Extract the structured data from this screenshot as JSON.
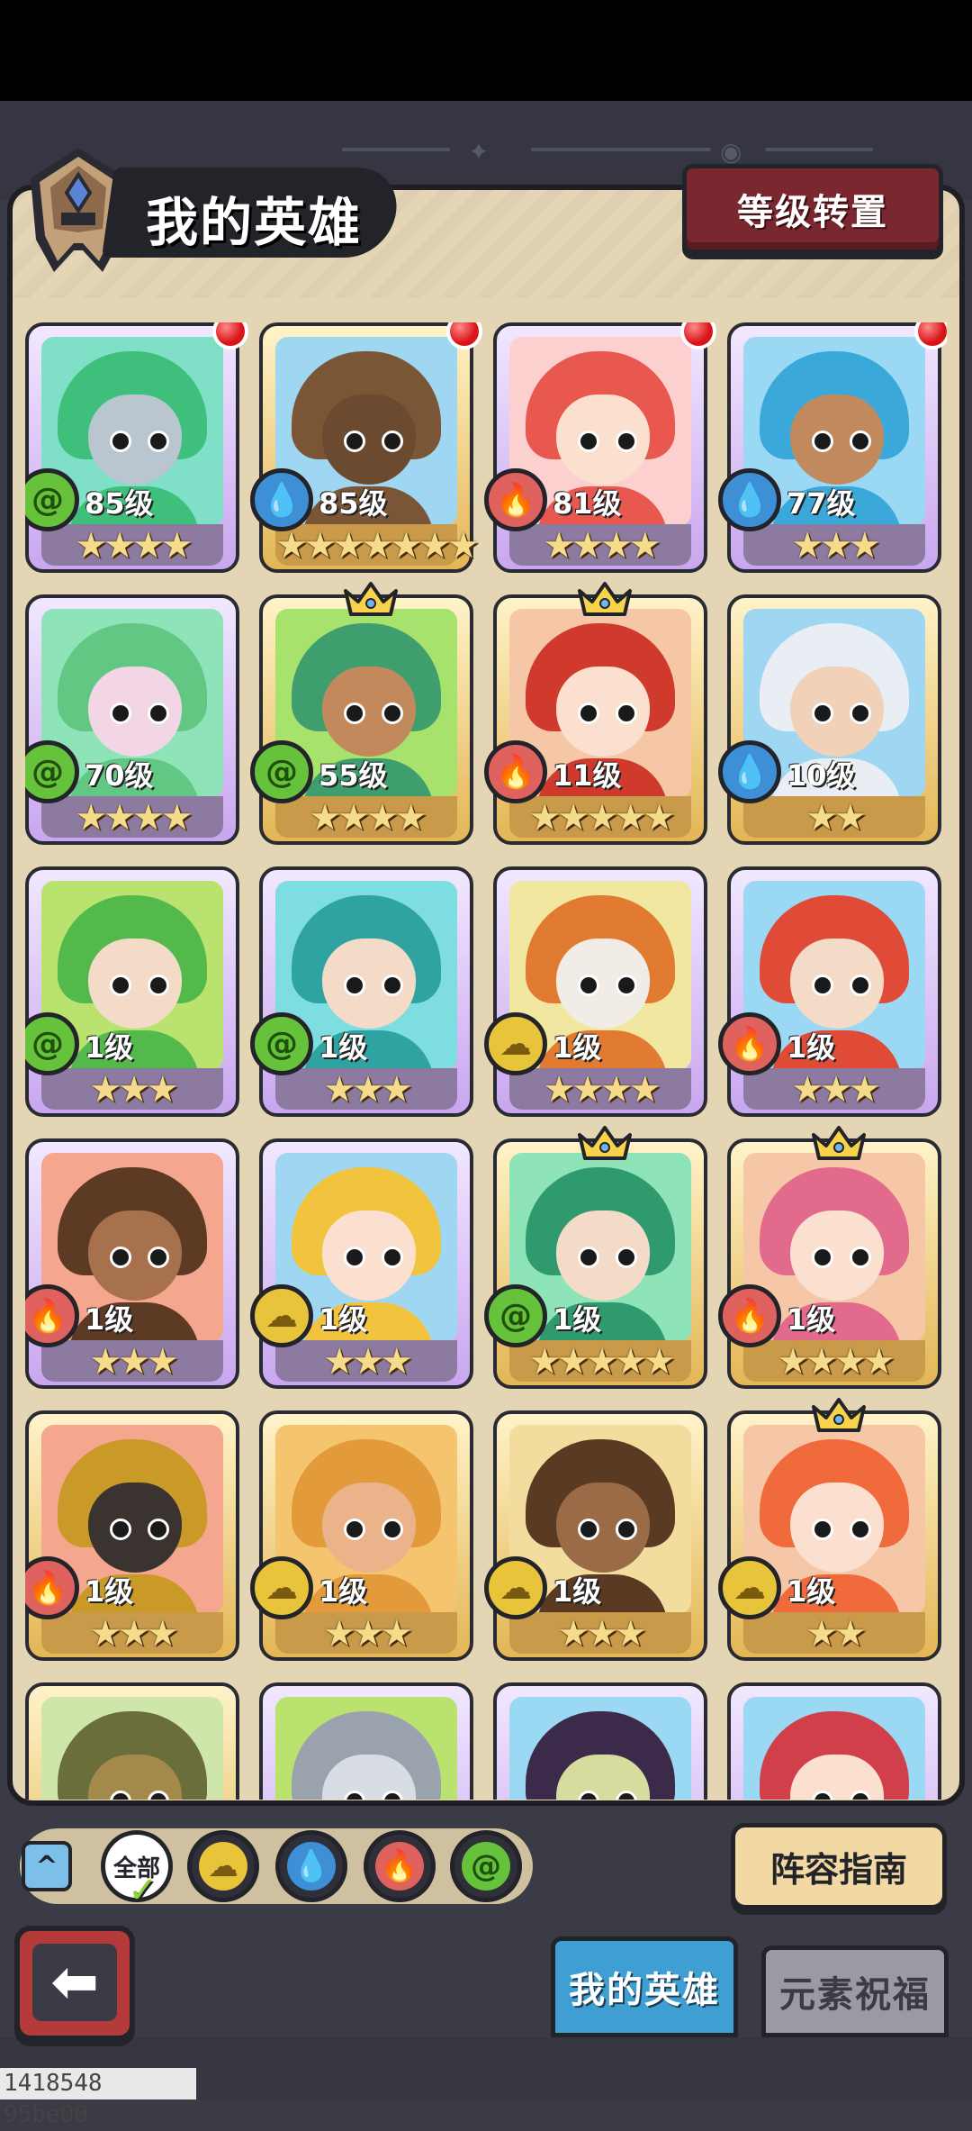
{
  "header": {
    "title": "我的英雄",
    "transfer_button": "等级转置"
  },
  "heroes": [
    {
      "level": "85级",
      "stars": "★★★★",
      "element": "wind",
      "frame": "purple",
      "dot": true,
      "crown": false,
      "hair": "#3fbf7c",
      "skin": "#b9c6cf",
      "bg": "#7fe0c7"
    },
    {
      "level": "85级",
      "stars": "★★★★★★★",
      "element": "water",
      "frame": "gold",
      "dot": true,
      "crown": false,
      "hair": "#7a5536",
      "skin": "#6b4a30",
      "bg": "#9fd6f1"
    },
    {
      "level": "81级",
      "stars": "★★★★",
      "element": "fire",
      "frame": "purple",
      "dot": true,
      "crown": false,
      "hair": "#e8584f",
      "skin": "#fbe0cf",
      "bg": "#fbd0cf"
    },
    {
      "level": "77级",
      "stars": "★★★",
      "element": "water",
      "frame": "purple",
      "dot": true,
      "crown": false,
      "hair": "#3aa8d8",
      "skin": "#c08a5e",
      "bg": "#9bd8f3"
    },
    {
      "level": "70级",
      "stars": "★★★★",
      "element": "wind",
      "frame": "purple",
      "dot": false,
      "crown": false,
      "hair": "#63c784",
      "skin": "#f3d6e6",
      "bg": "#8fe3b8"
    },
    {
      "level": "55级",
      "stars": "★★★★",
      "element": "wind",
      "frame": "gold",
      "dot": false,
      "crown": true,
      "hair": "#3f9e6d",
      "skin": "#c28a5c",
      "bg": "#a7e26c"
    },
    {
      "level": "11级",
      "stars": "★★★★★",
      "element": "fire",
      "frame": "gold",
      "dot": false,
      "crown": true,
      "hair": "#cf3a2c",
      "skin": "#fbe0cf",
      "bg": "#f5c7a7"
    },
    {
      "level": "10级",
      "stars": "★★",
      "element": "water",
      "frame": "gold",
      "dot": false,
      "crown": false,
      "hair": "#e8eef3",
      "skin": "#f1d2b9",
      "bg": "#9fd6f1"
    },
    {
      "level": "1级",
      "stars": "★★★",
      "element": "wind",
      "frame": "purple",
      "dot": false,
      "crown": false,
      "hair": "#53b94a",
      "skin": "#f4dbc8",
      "bg": "#b9e26f"
    },
    {
      "level": "1级",
      "stars": "★★★",
      "element": "wind",
      "frame": "purple",
      "dot": false,
      "crown": false,
      "hair": "#2fa3a1",
      "skin": "#f4dbc8",
      "bg": "#7ddde0"
    },
    {
      "level": "1级",
      "stars": "★★★★",
      "element": "earth",
      "frame": "purple",
      "dot": false,
      "crown": false,
      "hair": "#e27b32",
      "skin": "#f2ece6",
      "bg": "#f1e7a0"
    },
    {
      "level": "1级",
      "stars": "★★★",
      "element": "fire",
      "frame": "purple",
      "dot": false,
      "crown": false,
      "hair": "#e04b38",
      "skin": "#f4dbc8",
      "bg": "#9bd8f3"
    },
    {
      "level": "1级",
      "stars": "★★★",
      "element": "fire",
      "frame": "purple",
      "dot": false,
      "crown": false,
      "hair": "#5d3a24",
      "skin": "#a6714c",
      "bg": "#f4a68e"
    },
    {
      "level": "1级",
      "stars": "★★★",
      "element": "earth",
      "frame": "purple",
      "dot": false,
      "crown": false,
      "hair": "#f2c33d",
      "skin": "#fbe0cf",
      "bg": "#9fd6f1"
    },
    {
      "level": "1级",
      "stars": "★★★★★",
      "element": "wind",
      "frame": "gold",
      "dot": false,
      "crown": true,
      "hair": "#2e9a6e",
      "skin": "#f4dbc8",
      "bg": "#8fe3b8"
    },
    {
      "level": "1级",
      "stars": "★★★★",
      "element": "fire",
      "frame": "gold",
      "dot": false,
      "crown": true,
      "hair": "#e26a8c",
      "skin": "#fbe0cf",
      "bg": "#f5c7a7"
    },
    {
      "level": "1级",
      "stars": "★★★",
      "element": "fire",
      "frame": "gold",
      "dot": false,
      "crown": false,
      "hair": "#c99a28",
      "skin": "#3a3330",
      "bg": "#f4a68e"
    },
    {
      "level": "1级",
      "stars": "★★★",
      "element": "earth",
      "frame": "gold",
      "dot": false,
      "crown": false,
      "hair": "#e39a3a",
      "skin": "#eab38a",
      "bg": "#f4c56e"
    },
    {
      "level": "1级",
      "stars": "★★★",
      "element": "earth",
      "frame": "gold",
      "dot": false,
      "crown": false,
      "hair": "#5a3a22",
      "skin": "#9b6a46",
      "bg": "#f3dd9e"
    },
    {
      "level": "1级",
      "stars": "★★",
      "element": "earth",
      "frame": "gold",
      "dot": false,
      "crown": true,
      "hair": "#f06a3c",
      "skin": "#fbe0cf",
      "bg": "#f5c7a7"
    },
    {
      "level": "",
      "stars": "",
      "element": "",
      "frame": "gold",
      "dot": false,
      "crown": false,
      "hair": "#6a6e3a",
      "skin": "#a48a4a",
      "bg": "#cfe6ab"
    },
    {
      "level": "",
      "stars": "",
      "element": "",
      "frame": "purple",
      "dot": false,
      "crown": false,
      "hair": "#9aa3ad",
      "skin": "#d7dde3",
      "bg": "#b9e26f"
    },
    {
      "level": "",
      "stars": "",
      "element": "",
      "frame": "purple",
      "dot": false,
      "crown": false,
      "hair": "#3c2a4a",
      "skin": "#d6db9e",
      "bg": "#9bd8f3"
    },
    {
      "level": "",
      "stars": "",
      "element": "",
      "frame": "purple",
      "dot": false,
      "crown": false,
      "hair": "#d1404a",
      "skin": "#fbe0cf",
      "bg": "#9bd8f3"
    }
  ],
  "filters": {
    "all_label": "全部",
    "items": [
      "earth",
      "water",
      "fire",
      "wind"
    ]
  },
  "guide_button": "阵容指南",
  "tabs": {
    "my_heroes": "我的英雄",
    "element_blessing": "元素祝福"
  },
  "watermark": "1418548 95be00",
  "colors": {
    "wind": "#66c23a",
    "water": "#3d8fd6",
    "fire": "#e0625e",
    "earth": "#e7c43a"
  }
}
